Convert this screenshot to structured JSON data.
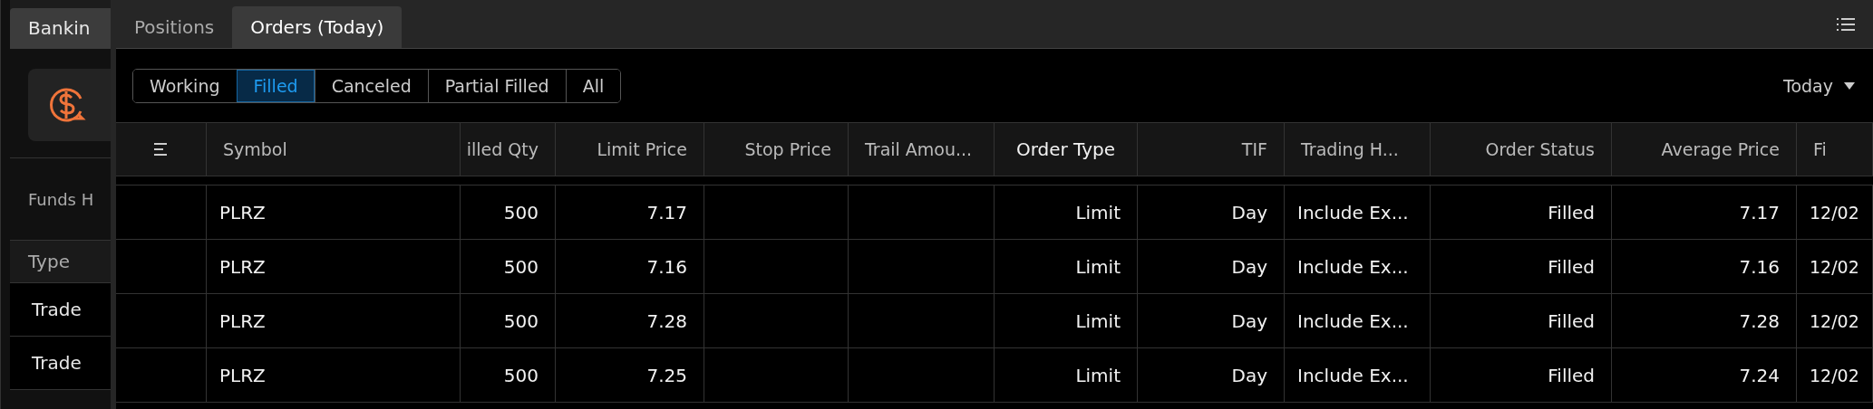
{
  "background_panel": {
    "tab": "Bankin",
    "funds_label": "Funds H",
    "column": "Type",
    "rows": [
      "Trade",
      "Trade"
    ]
  },
  "tabs": [
    {
      "label": "Positions",
      "selected": false
    },
    {
      "label": "Orders (Today)",
      "selected": true
    }
  ],
  "filters": [
    {
      "label": "Working",
      "selected": false
    },
    {
      "label": "Filled",
      "selected": true
    },
    {
      "label": "Canceled",
      "selected": false
    },
    {
      "label": "Partial Filled",
      "selected": false
    },
    {
      "label": "All",
      "selected": false
    }
  ],
  "period": {
    "value": "Today"
  },
  "table": {
    "columns": [
      "Symbol",
      "illed Qty",
      "Limit Price",
      "Stop Price",
      "Trail Amou...",
      "Order Type",
      "TIF",
      "Trading H...",
      "Order Status",
      "Average Price",
      "Fi"
    ],
    "rows": [
      [
        "PLRZ",
        "500",
        "7.17",
        null,
        null,
        "Limit",
        "Day",
        "Include Ex...",
        "Filled",
        "7.17",
        "12/02"
      ],
      [
        "PLRZ",
        "500",
        "7.16",
        null,
        null,
        "Limit",
        "Day",
        "Include Ex...",
        "Filled",
        "7.16",
        "12/02"
      ],
      [
        "PLRZ",
        "500",
        "7.28",
        null,
        null,
        "Limit",
        "Day",
        "Include Ex...",
        "Filled",
        "7.28",
        "12/02"
      ],
      [
        "PLRZ",
        "500",
        "7.25",
        null,
        null,
        "Limit",
        "Day",
        "Include Ex...",
        "Filled",
        "7.24",
        "12/02"
      ]
    ]
  }
}
